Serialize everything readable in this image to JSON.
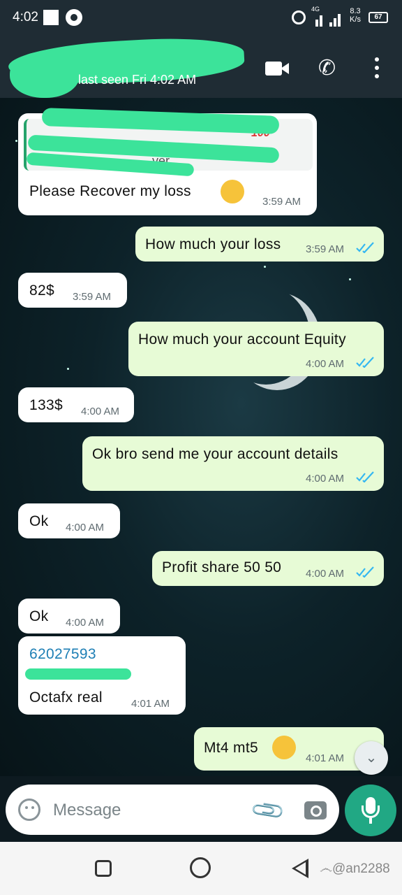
{
  "status_bar": {
    "time": "4:02",
    "network": "4G",
    "speed": "8.3",
    "speed_unit": "K/s",
    "battery": "67"
  },
  "header": {
    "status": "last seen Fri 4:02 AM"
  },
  "messages": [
    {
      "dir": "in",
      "text": "Please Recover my loss",
      "time": "3:59 AM",
      "has_quote": true,
      "quote_fragment": "ver"
    },
    {
      "dir": "out",
      "text": "How much your loss",
      "time": "3:59 AM"
    },
    {
      "dir": "in",
      "text": "82$",
      "time": "3:59 AM"
    },
    {
      "dir": "out",
      "text": "How much your account Equity",
      "time": "4:00 AM"
    },
    {
      "dir": "in",
      "text": "133$",
      "time": "4:00 AM"
    },
    {
      "dir": "out",
      "text": "Ok bro send me your account details",
      "time": "4:00 AM"
    },
    {
      "dir": "in",
      "text": "Ok",
      "time": "4:00 AM"
    },
    {
      "dir": "out",
      "text": "Profit share 50 50",
      "time": "4:00 AM"
    },
    {
      "dir": "in",
      "text": "Ok",
      "time": "4:00 AM"
    },
    {
      "dir": "in",
      "line1": "62027593",
      "line2": "Octafx real",
      "time": "4:01 AM"
    },
    {
      "dir": "out",
      "text": "Mt4 mt5",
      "time": "4:01 AM"
    }
  ],
  "input": {
    "placeholder": "Message"
  },
  "watermark": "෴@an2288",
  "colors": {
    "header_bg": "#1f2c34",
    "outgoing_bubble": "#e7fbd6",
    "incoming_bubble": "#ffffff",
    "read_ticks": "#34b7f1",
    "mic_button": "#21a884",
    "redaction": "#3ce39a"
  },
  "icons": [
    "whatsapp-icon",
    "alarm-icon",
    "signal-icon",
    "battery-icon",
    "back-arrow-icon",
    "video-call-icon",
    "phone-icon",
    "more-options-icon",
    "double-tick-icon",
    "scroll-down-icon",
    "emoji-icon",
    "attach-icon",
    "camera-icon",
    "mic-icon",
    "nav-recent-icon",
    "nav-home-icon",
    "nav-back-icon"
  ]
}
